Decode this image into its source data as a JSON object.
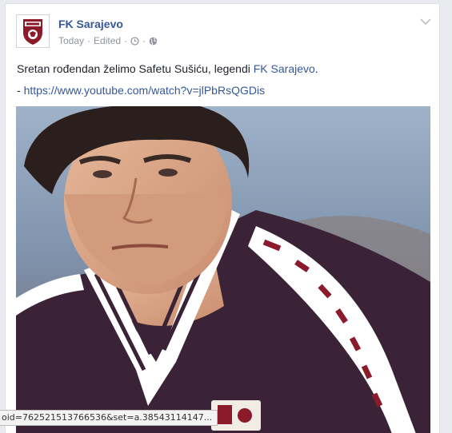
{
  "post": {
    "page_name": "FK Sarajevo",
    "timestamp": "Today",
    "edited_label": "Edited",
    "separator": "·",
    "text_before": "Sretan rođendan želimo Safetu Sušiću, legendi ",
    "text_link": "FK Sarajevo",
    "text_after": ".",
    "link_prefix": "- ",
    "link_url": "https://www.youtube.com/watch?v=jlPbRsQGDis"
  },
  "icons": {
    "clock": "clock-icon",
    "globe": "globe-icon",
    "chevron": "chevron-down-icon"
  },
  "colors": {
    "link": "#365899",
    "club_maroon": "#8b1a2b"
  },
  "status_bar": {
    "url_fragment": "oid=762521513766536&set=a.38543114147..."
  }
}
